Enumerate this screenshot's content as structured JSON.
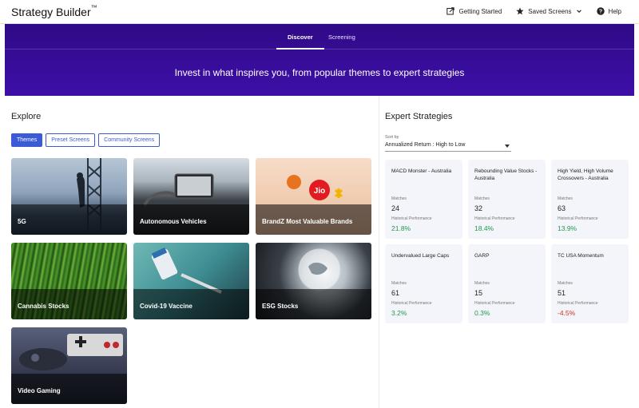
{
  "app": {
    "title": "Strategy Builder",
    "tm": "™"
  },
  "nav": {
    "getting_started": "Getting Started",
    "saved_screens": "Saved Screens",
    "help": "Help"
  },
  "hero": {
    "tabs": [
      {
        "label": "Discover"
      },
      {
        "label": "Screening"
      }
    ],
    "tagline": "Invest in what inspires you, from popular themes to expert strategies"
  },
  "explore": {
    "title": "Explore",
    "pills": [
      {
        "label": "Themes"
      },
      {
        "label": "Preset Screens"
      },
      {
        "label": "Community Screens"
      }
    ],
    "themes": [
      {
        "label": "5G"
      },
      {
        "label": "Autonomous Vehicles"
      },
      {
        "label": "BrandZ Most Valuable Brands"
      },
      {
        "label": "Cannabis Stocks"
      },
      {
        "label": "Covid-19 Vaccine"
      },
      {
        "label": "ESG Stocks"
      },
      {
        "label": "Video Gaming"
      }
    ]
  },
  "expert": {
    "title": "Expert Strategies",
    "sort_label": "Sort by",
    "sort_value": "Annualized Return : High to Low",
    "matches_label": "Matches",
    "perf_label": "Historical Performance",
    "strategies": [
      {
        "name": "MACD Monster - Australia",
        "matches": "24",
        "performance": "21.8%",
        "trend": "positive"
      },
      {
        "name": "Rebounding Value Stocks - Australia",
        "matches": "32",
        "performance": "18.4%",
        "trend": "positive"
      },
      {
        "name": "High Yield, High Volume Crossovers - Australia",
        "matches": "63",
        "performance": "13.9%",
        "trend": "positive"
      },
      {
        "name": "Undervalued Large Caps",
        "matches": "61",
        "performance": "3.2%",
        "trend": "positive"
      },
      {
        "name": "GARP",
        "matches": "15",
        "performance": "0.3%",
        "trend": "positive"
      },
      {
        "name": "TC USA Momentum",
        "matches": "51",
        "performance": "-4.5%",
        "trend": "negative"
      }
    ]
  },
  "colors": {
    "hero": "#3a0ca0",
    "accent": "#3b5bd6",
    "positive": "#1f9a4c",
    "negative": "#d93025"
  }
}
